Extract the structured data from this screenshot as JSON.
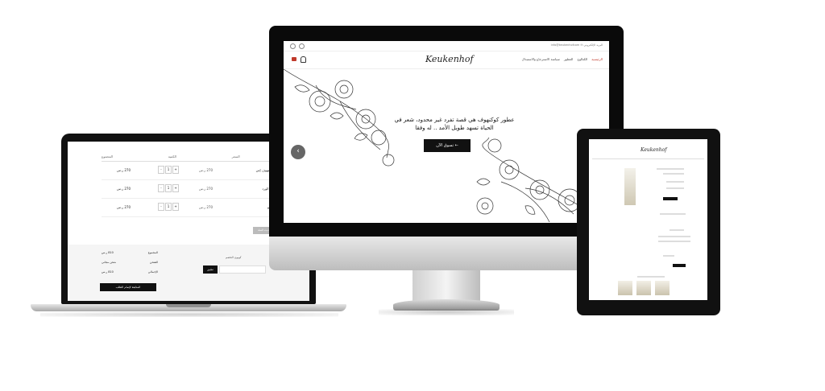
{
  "laptop": {
    "cart": {
      "headers": [
        "المنتج",
        "السعر",
        "الكمية",
        "المجموع"
      ],
      "rows": [
        {
          "name": "كوكنهوف إس",
          "price": "270 ر.س",
          "qty": [
            "+",
            "1",
            "-"
          ],
          "total": "270 ر.س"
        },
        {
          "name": "ماء الورد",
          "price": "270 ر.س",
          "qty": [
            "+",
            "1",
            "-"
          ],
          "total": "270 ر.س"
        },
        {
          "name": "كوكو",
          "price": "270 ر.س",
          "qty": [
            "+",
            "1",
            "-"
          ],
          "total": "270 ر.س"
        }
      ],
      "update_label": "تحديث السلة"
    },
    "coupon": {
      "label": "كوبون الخصم",
      "apply_label": "تطبيق"
    },
    "totals": {
      "lines": [
        {
          "label": "المجموع",
          "value": "810 ر.س"
        },
        {
          "label": "الشحن",
          "value": "شحن مجاني"
        },
        {
          "label": "الإجمالي",
          "value": "810 ر.س"
        }
      ],
      "checkout_label": "المتابعة لإتمام الطلب"
    }
  },
  "monitor": {
    "contact": "info@keukenhofcom ✉   البريد الإلكتروني",
    "logo": "Keukenhof",
    "nav": [
      "الرئيسية",
      "الكتالوج",
      "العطور",
      "سياسة الاسترجاع والاستبدال"
    ],
    "hero": {
      "tagline": "عطور كوكنهوف هي قصة تفرد غير محدود، شعر في الحياة تسهد طويل الأمد .. له وفقا",
      "shop_label": "تسوق الآن ←",
      "prev": "‹",
      "next": "›"
    }
  },
  "tablet": {
    "logo": "Keukenhof"
  },
  "colors": {
    "accent": "#c0392b",
    "dark": "#111111"
  }
}
